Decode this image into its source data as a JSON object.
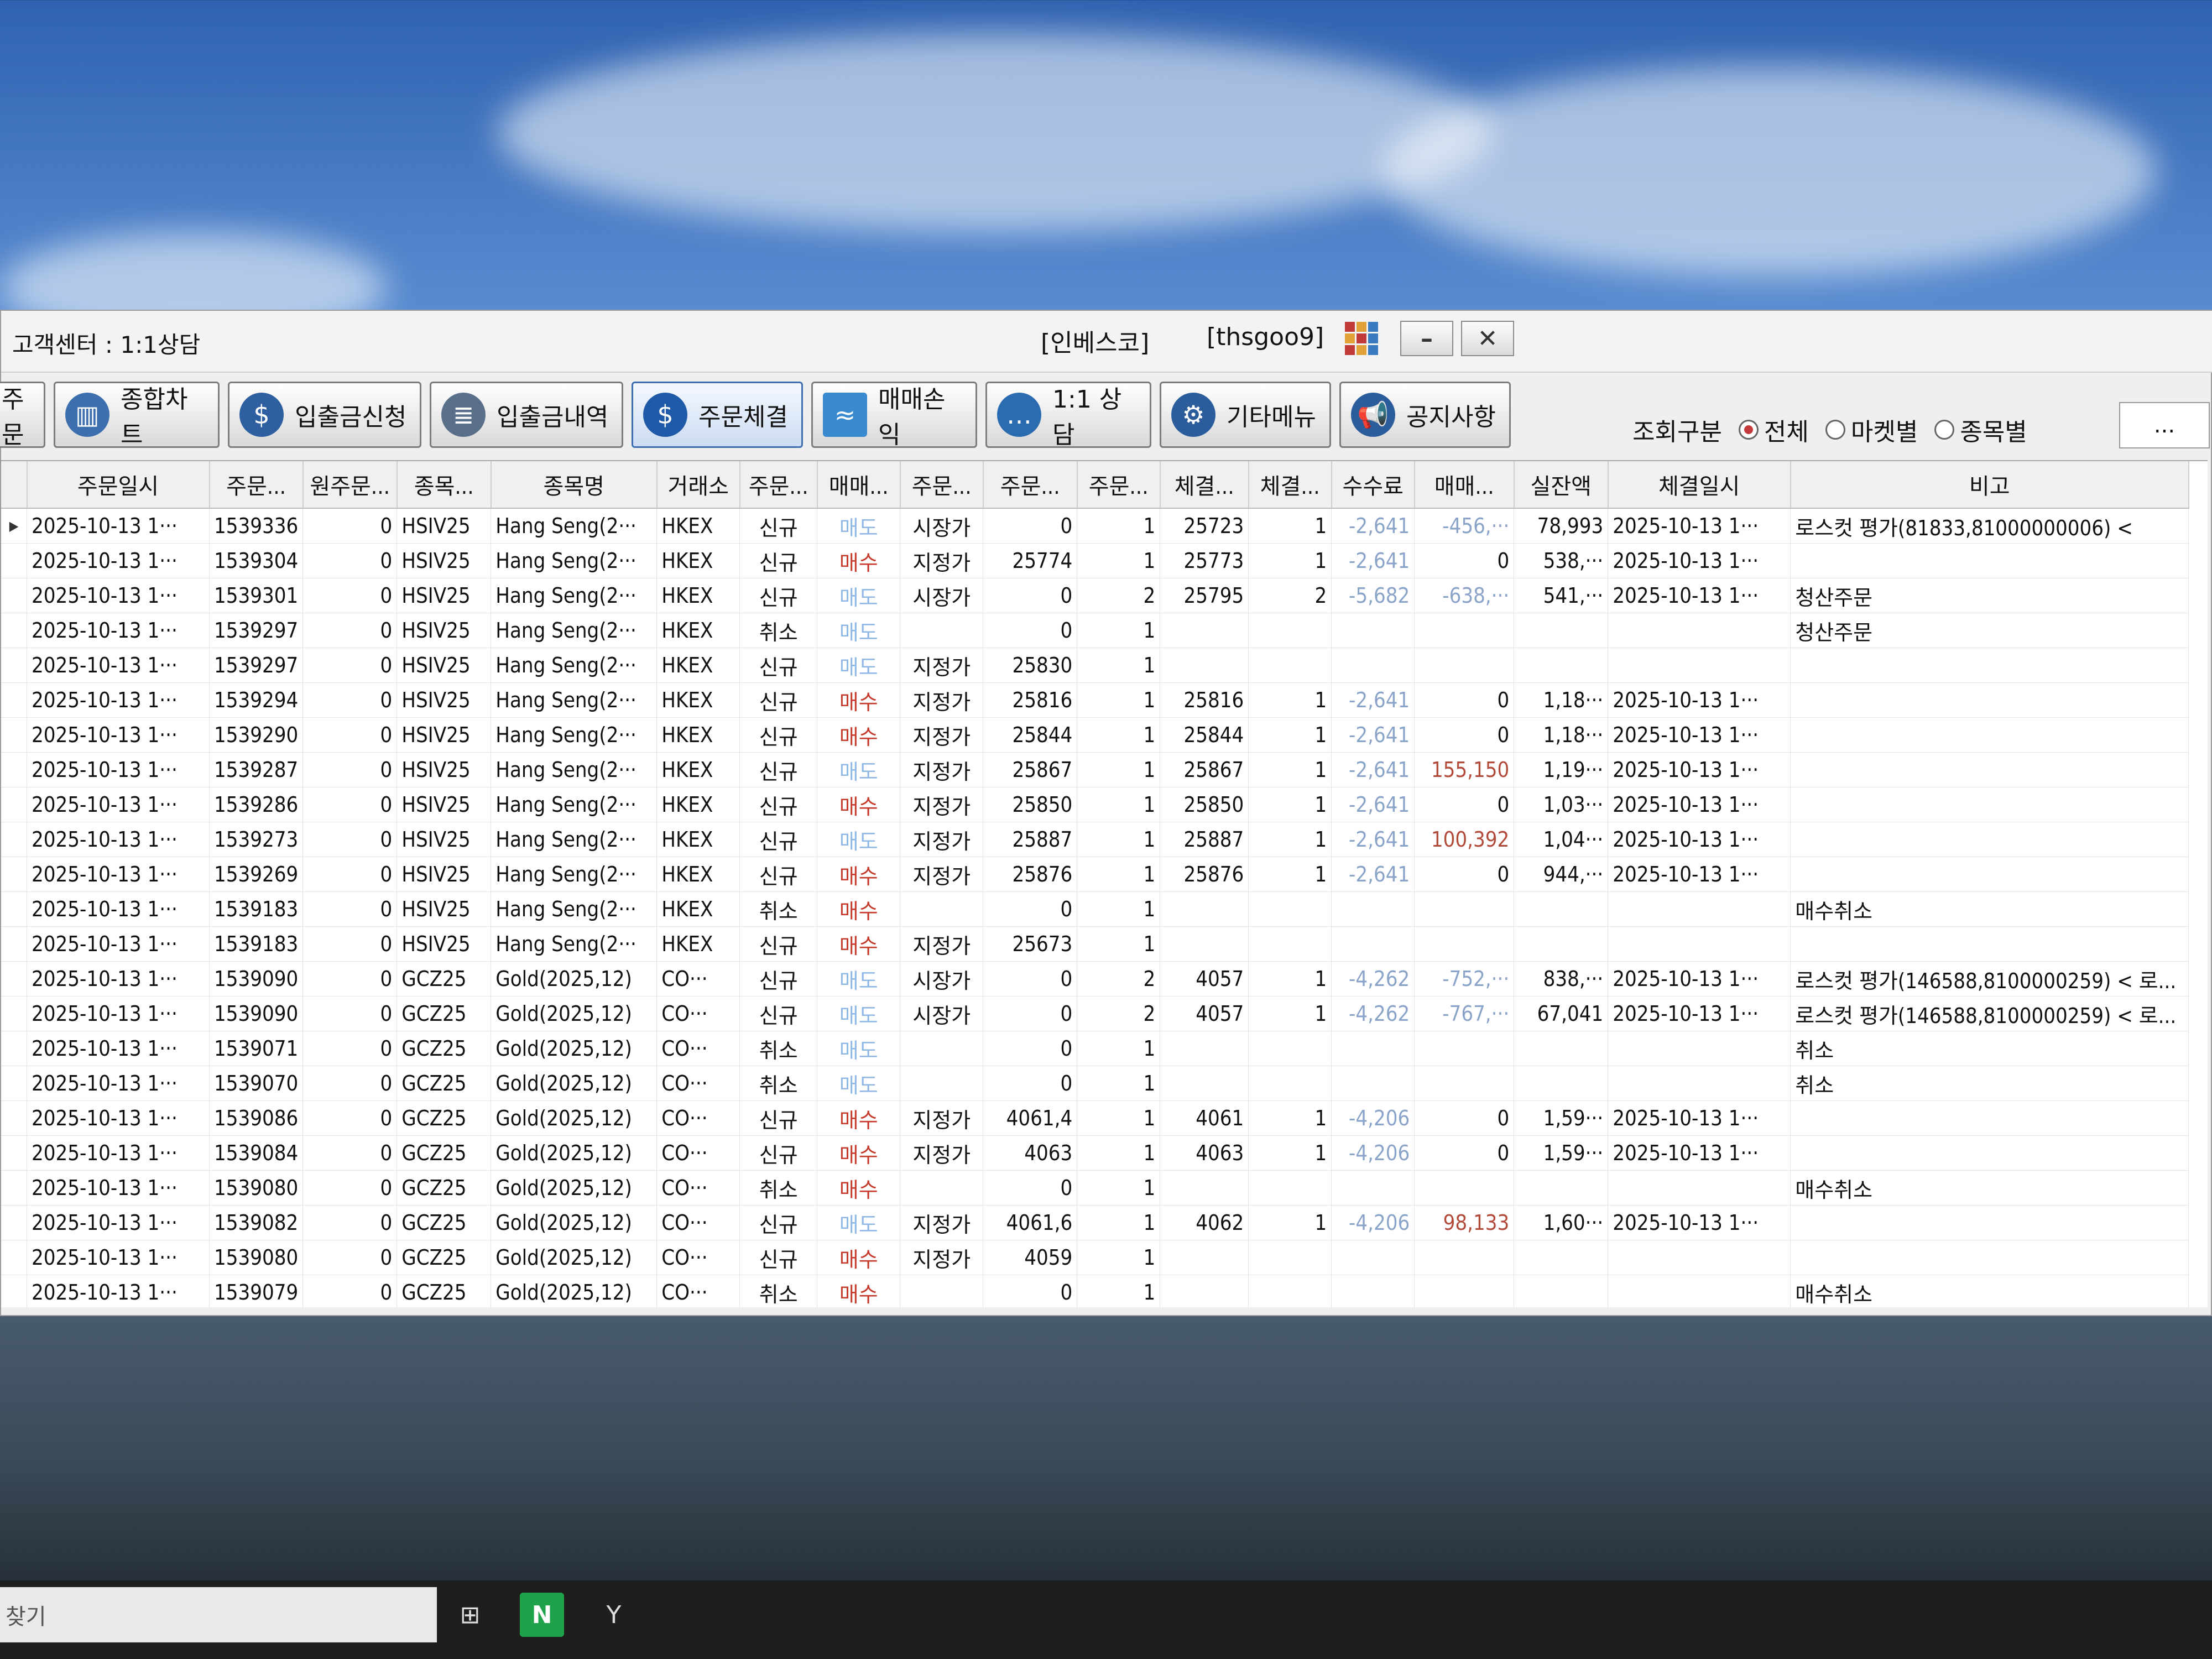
{
  "window": {
    "title": "고객센터 : 1:1상담",
    "broker": "[인베스코]",
    "user": "[thsgoo9]",
    "minimize_icon": "minimize-icon",
    "close_icon": "close-icon"
  },
  "toolbar": {
    "partial_label": "주문",
    "buttons": [
      {
        "label": "종합차트",
        "icon": "chart-icon"
      },
      {
        "label": "입출금신청",
        "icon": "money-bag-icon"
      },
      {
        "label": "입출금내역",
        "icon": "ledger-icon"
      },
      {
        "label": "주문체결",
        "icon": "coin-icon"
      },
      {
        "label": "매매손익",
        "icon": "profit-chart-icon"
      },
      {
        "label": "1:1 상담",
        "icon": "chat-icon"
      },
      {
        "label": "기타메뉴",
        "icon": "gear-icon"
      },
      {
        "label": "공지사항",
        "icon": "megaphone-icon"
      }
    ]
  },
  "filter": {
    "label": "조회구분",
    "options": [
      "전체",
      "마켓별",
      "종목별"
    ],
    "selected": "전체",
    "more": "..."
  },
  "table": {
    "columns": [
      "주문일시",
      "주문...",
      "원주문...",
      "종목...",
      "종목명",
      "거래소",
      "주문...",
      "매매...",
      "주문...",
      "주문...",
      "주문...",
      "체결...",
      "체결...",
      "수수료",
      "매매...",
      "실잔액",
      "체결일시",
      "비고"
    ],
    "rows": [
      [
        "2025-10-13 1···",
        "1539336",
        "0",
        "HSIV25",
        "Hang Seng(2···",
        "HKEX",
        "신규",
        "매도",
        "시장가",
        "0",
        "1",
        "25723",
        "1",
        "-2,641",
        "-456,···",
        "78,993",
        "2025-10-13 1···",
        "로스컷 평가(81833,81000000006) <"
      ],
      [
        "2025-10-13 1···",
        "1539304",
        "0",
        "HSIV25",
        "Hang Seng(2···",
        "HKEX",
        "신규",
        "매수",
        "지정가",
        "25774",
        "1",
        "25773",
        "1",
        "-2,641",
        "0",
        "538,···",
        "2025-10-13 1···",
        ""
      ],
      [
        "2025-10-13 1···",
        "1539301",
        "0",
        "HSIV25",
        "Hang Seng(2···",
        "HKEX",
        "신규",
        "매도",
        "시장가",
        "0",
        "2",
        "25795",
        "2",
        "-5,682",
        "-638,···",
        "541,···",
        "2025-10-13 1···",
        "청산주문"
      ],
      [
        "2025-10-13 1···",
        "1539297",
        "0",
        "HSIV25",
        "Hang Seng(2···",
        "HKEX",
        "취소",
        "매도",
        "",
        "0",
        "1",
        "",
        "",
        "",
        "",
        "",
        "",
        "청산주문"
      ],
      [
        "2025-10-13 1···",
        "1539297",
        "0",
        "HSIV25",
        "Hang Seng(2···",
        "HKEX",
        "신규",
        "매도",
        "지정가",
        "25830",
        "1",
        "",
        "",
        "",
        "",
        "",
        "",
        ""
      ],
      [
        "2025-10-13 1···",
        "1539294",
        "0",
        "HSIV25",
        "Hang Seng(2···",
        "HKEX",
        "신규",
        "매수",
        "지정가",
        "25816",
        "1",
        "25816",
        "1",
        "-2,641",
        "0",
        "1,18···",
        "2025-10-13 1···",
        ""
      ],
      [
        "2025-10-13 1···",
        "1539290",
        "0",
        "HSIV25",
        "Hang Seng(2···",
        "HKEX",
        "신규",
        "매수",
        "지정가",
        "25844",
        "1",
        "25844",
        "1",
        "-2,641",
        "0",
        "1,18···",
        "2025-10-13 1···",
        ""
      ],
      [
        "2025-10-13 1···",
        "1539287",
        "0",
        "HSIV25",
        "Hang Seng(2···",
        "HKEX",
        "신규",
        "매도",
        "지정가",
        "25867",
        "1",
        "25867",
        "1",
        "-2,641",
        "155,150",
        "1,19···",
        "2025-10-13 1···",
        ""
      ],
      [
        "2025-10-13 1···",
        "1539286",
        "0",
        "HSIV25",
        "Hang Seng(2···",
        "HKEX",
        "신규",
        "매수",
        "지정가",
        "25850",
        "1",
        "25850",
        "1",
        "-2,641",
        "0",
        "1,03···",
        "2025-10-13 1···",
        ""
      ],
      [
        "2025-10-13 1···",
        "1539273",
        "0",
        "HSIV25",
        "Hang Seng(2···",
        "HKEX",
        "신규",
        "매도",
        "지정가",
        "25887",
        "1",
        "25887",
        "1",
        "-2,641",
        "100,392",
        "1,04···",
        "2025-10-13 1···",
        ""
      ],
      [
        "2025-10-13 1···",
        "1539269",
        "0",
        "HSIV25",
        "Hang Seng(2···",
        "HKEX",
        "신규",
        "매수",
        "지정가",
        "25876",
        "1",
        "25876",
        "1",
        "-2,641",
        "0",
        "944,···",
        "2025-10-13 1···",
        ""
      ],
      [
        "2025-10-13 1···",
        "1539183",
        "0",
        "HSIV25",
        "Hang Seng(2···",
        "HKEX",
        "취소",
        "매수",
        "",
        "0",
        "1",
        "",
        "",
        "",
        "",
        "",
        "",
        "매수취소"
      ],
      [
        "2025-10-13 1···",
        "1539183",
        "0",
        "HSIV25",
        "Hang Seng(2···",
        "HKEX",
        "신규",
        "매수",
        "지정가",
        "25673",
        "1",
        "",
        "",
        "",
        "",
        "",
        "",
        ""
      ],
      [
        "2025-10-13 1···",
        "1539090",
        "0",
        "GCZ25",
        "Gold(2025,12)",
        "CO···",
        "신규",
        "매도",
        "시장가",
        "0",
        "2",
        "4057",
        "1",
        "-4,262",
        "-752,···",
        "838,···",
        "2025-10-13 1···",
        "로스컷 평가(146588,8100000259) < 로..."
      ],
      [
        "2025-10-13 1···",
        "1539090",
        "0",
        "GCZ25",
        "Gold(2025,12)",
        "CO···",
        "신규",
        "매도",
        "시장가",
        "0",
        "2",
        "4057",
        "1",
        "-4,262",
        "-767,···",
        "67,041",
        "2025-10-13 1···",
        "로스컷 평가(146588,8100000259) < 로..."
      ],
      [
        "2025-10-13 1···",
        "1539071",
        "0",
        "GCZ25",
        "Gold(2025,12)",
        "CO···",
        "취소",
        "매도",
        "",
        "0",
        "1",
        "",
        "",
        "",
        "",
        "",
        "",
        "취소"
      ],
      [
        "2025-10-13 1···",
        "1539070",
        "0",
        "GCZ25",
        "Gold(2025,12)",
        "CO···",
        "취소",
        "매도",
        "",
        "0",
        "1",
        "",
        "",
        "",
        "",
        "",
        "",
        "취소"
      ],
      [
        "2025-10-13 1···",
        "1539086",
        "0",
        "GCZ25",
        "Gold(2025,12)",
        "CO···",
        "신규",
        "매수",
        "지정가",
        "4061,4",
        "1",
        "4061",
        "1",
        "-4,206",
        "0",
        "1,59···",
        "2025-10-13 1···",
        ""
      ],
      [
        "2025-10-13 1···",
        "1539084",
        "0",
        "GCZ25",
        "Gold(2025,12)",
        "CO···",
        "신규",
        "매수",
        "지정가",
        "4063",
        "1",
        "4063",
        "1",
        "-4,206",
        "0",
        "1,59···",
        "2025-10-13 1···",
        ""
      ],
      [
        "2025-10-13 1···",
        "1539080",
        "0",
        "GCZ25",
        "Gold(2025,12)",
        "CO···",
        "취소",
        "매수",
        "",
        "0",
        "1",
        "",
        "",
        "",
        "",
        "",
        "",
        "매수취소"
      ],
      [
        "2025-10-13 1···",
        "1539082",
        "0",
        "GCZ25",
        "Gold(2025,12)",
        "CO···",
        "신규",
        "매도",
        "지정가",
        "4061,6",
        "1",
        "4062",
        "1",
        "-4,206",
        "98,133",
        "1,60···",
        "2025-10-13 1···",
        ""
      ],
      [
        "2025-10-13 1···",
        "1539080",
        "0",
        "GCZ25",
        "Gold(2025,12)",
        "CO···",
        "신규",
        "매수",
        "지정가",
        "4059",
        "1",
        "",
        "",
        "",
        "",
        "",
        "",
        ""
      ],
      [
        "2025-10-13 1···",
        "1539079",
        "0",
        "GCZ25",
        "Gold(2025,12)",
        "CO···",
        "취소",
        "매수",
        "",
        "0",
        "1",
        "",
        "",
        "",
        "",
        "",
        "",
        "매수취소"
      ]
    ]
  },
  "taskbar": {
    "search_placeholder": "찾기",
    "apps": [
      {
        "label": "⊞",
        "icon": "task-view-icon"
      },
      {
        "label": "N",
        "icon": "naver-icon"
      },
      {
        "label": "Y",
        "icon": "app-icon"
      }
    ]
  },
  "colors": {
    "sell": "#8fb8e6",
    "buy": "#c53a2a",
    "selected_radio": "#c43a3a"
  }
}
